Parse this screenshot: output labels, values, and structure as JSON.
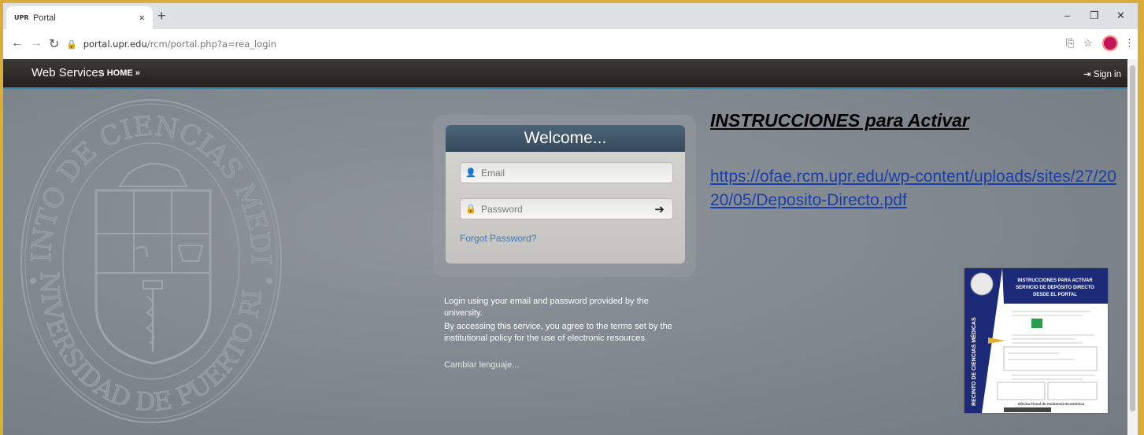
{
  "browser": {
    "tab_title": "Portal",
    "tab_favicon_text": "UPR",
    "tab_close": "×",
    "new_tab": "+",
    "url_domain": "portal.upr.edu",
    "url_path": "/rcm/portal.php?a=rea_login",
    "window_minimize": "–",
    "window_restore": "❐",
    "window_close": "✕",
    "icons": [
      "back-icon",
      "forward-icon",
      "reload-icon",
      "lock-icon",
      "translate-icon",
      "star-icon",
      "profile-avatar",
      "menu-icon"
    ]
  },
  "header": {
    "brand": "Web Services",
    "home_label": "HOME »",
    "signin_label": "Sign in",
    "accent": "#3c7fa0"
  },
  "login": {
    "title": "Welcome...",
    "email_placeholder": "Email",
    "password_placeholder": "Password",
    "forgot_label": "Forgot Password?",
    "info_line1": "Login using your email and password provided by the university.",
    "info_line2": "By accessing this service, you agree to the terms set by the institutional policy for the use of electronic resources.",
    "language_label": "Cambiar lenguaje..."
  },
  "seal": {
    "top_text": "RECINTO DE CIENCIAS MEDICAS",
    "bottom_text": "UNIVERSIDAD DE PUERTO RICO"
  },
  "instructions": {
    "title": "INSTRUCCIONES para Activar",
    "link": "https://ofae.rcm.upr.edu/wp-content/uploads/sites/27/2020/05/Deposito-Directo.pdf"
  },
  "document_thumbnail": {
    "side_text": "RECINTO DE CIENCIAS MÉDICAS",
    "title_line1": "INSTRUCCIONES PARA ACTIVAR",
    "title_line2": "SERVICIO DE DEPÓSITO DIRECTO",
    "title_line3": "DESDE EL PORTAL",
    "footer": "Oficina Fiscal de Asistencia Económica"
  }
}
